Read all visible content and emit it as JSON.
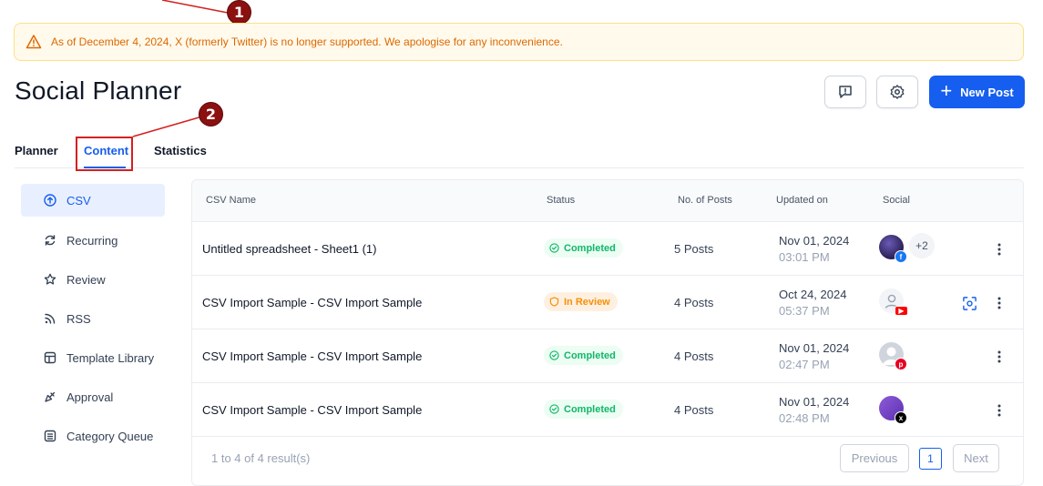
{
  "annotations": {
    "marker_1": "1",
    "marker_2": "2"
  },
  "banner": {
    "text": "As of December 4, 2024, X (formerly Twitter) is no longer supported. We apologise for any inconvenience.",
    "icon": "warning-icon"
  },
  "header": {
    "title": "Social Planner",
    "new_post_label": "New Post",
    "feedback_icon": "feedback-icon",
    "settings_icon": "gear-icon"
  },
  "tabs": [
    {
      "label": "Planner"
    },
    {
      "label": "Content"
    },
    {
      "label": "Statistics"
    }
  ],
  "active_tab": "Content",
  "sidebar": {
    "items": [
      {
        "label": "CSV",
        "icon": "upload-circle-icon",
        "active": true
      },
      {
        "label": "Recurring",
        "icon": "refresh-icon"
      },
      {
        "label": "Review",
        "icon": "star-icon"
      },
      {
        "label": "RSS",
        "icon": "rss-icon"
      },
      {
        "label": "Template Library",
        "icon": "template-icon"
      },
      {
        "label": "Approval",
        "icon": "approval-icon"
      },
      {
        "label": "Category Queue",
        "icon": "queue-icon"
      }
    ]
  },
  "table": {
    "columns": [
      "CSV Name",
      "Status",
      "No. of Posts",
      "Updated on",
      "Social"
    ],
    "rows": [
      {
        "name": "Untitled spreadsheet - Sheet1 (1)",
        "status": "Completed",
        "posts": "5 Posts",
        "date": "Nov 01, 2024",
        "time": "03:01 PM",
        "social": "facebook",
        "extra": "+2"
      },
      {
        "name": "CSV Import Sample - CSV Import Sample",
        "status": "In Review",
        "posts": "4 Posts",
        "date": "Oct 24, 2024",
        "time": "05:37 PM",
        "social": "youtube"
      },
      {
        "name": "CSV Import Sample - CSV Import Sample",
        "status": "Completed",
        "posts": "4 Posts",
        "date": "Nov 01, 2024",
        "time": "02:47 PM",
        "social": "pinterest"
      },
      {
        "name": "CSV Import Sample - CSV Import Sample",
        "status": "Completed",
        "posts": "4 Posts",
        "date": "Nov 01, 2024",
        "time": "02:48 PM",
        "social": "x"
      }
    ]
  },
  "pagination": {
    "summary": "1 to 4 of 4 result(s)",
    "previous": "Previous",
    "page": "1",
    "next": "Next"
  },
  "colors": {
    "primary": "#155eef",
    "warning": "#dc6803",
    "success": "#12b76a",
    "review": "#f79009",
    "annotation": "#8b1010"
  }
}
